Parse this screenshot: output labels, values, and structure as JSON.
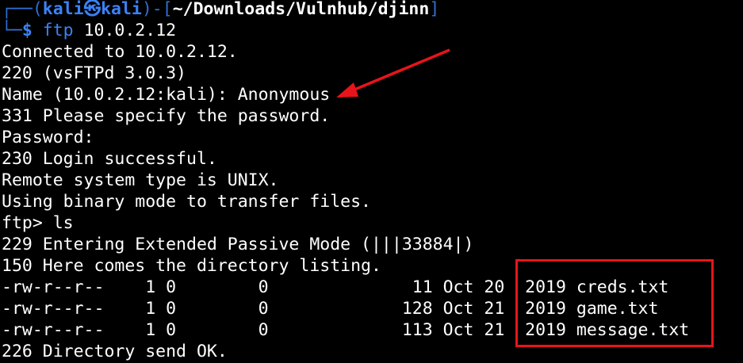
{
  "prompt": {
    "frame_top_left": "┌──(",
    "user": "kali",
    "at_symbol": "㉿",
    "host": "kali",
    "frame_mid": ")-[",
    "cwd": "~/Downloads/Vulnhub/djinn",
    "frame_close": "]",
    "frame_bottom_left": "└─",
    "dollar": "$",
    "command": "ftp",
    "command_args": " 10.0.2.12"
  },
  "output_lines": [
    "Connected to 10.0.2.12.",
    "220 (vsFTPd 3.0.3)",
    "Name (10.0.2.12:kali): Anonymous",
    "331 Please specify the password.",
    "Password:",
    "230 Login successful.",
    "Remote system type is UNIX.",
    "Using binary mode to transfer files.",
    "ftp> ls",
    "229 Entering Extended Passive Mode (|||33884|)",
    "150 Here comes the directory listing.",
    "-rw-r--r--    1 0        0              11 Oct 20  2019 creds.txt",
    "-rw-r--r--    1 0        0             128 Oct 21  2019 game.txt",
    "-rw-r--r--    1 0        0             113 Oct 21  2019 message.txt",
    "226 Directory send OK."
  ],
  "colors": {
    "background": "#000000",
    "text": "#ffffff",
    "prompt_blue": "#3b82f6",
    "frame_blue": "#2f6fd6",
    "annotation_red": "#e8141b"
  }
}
